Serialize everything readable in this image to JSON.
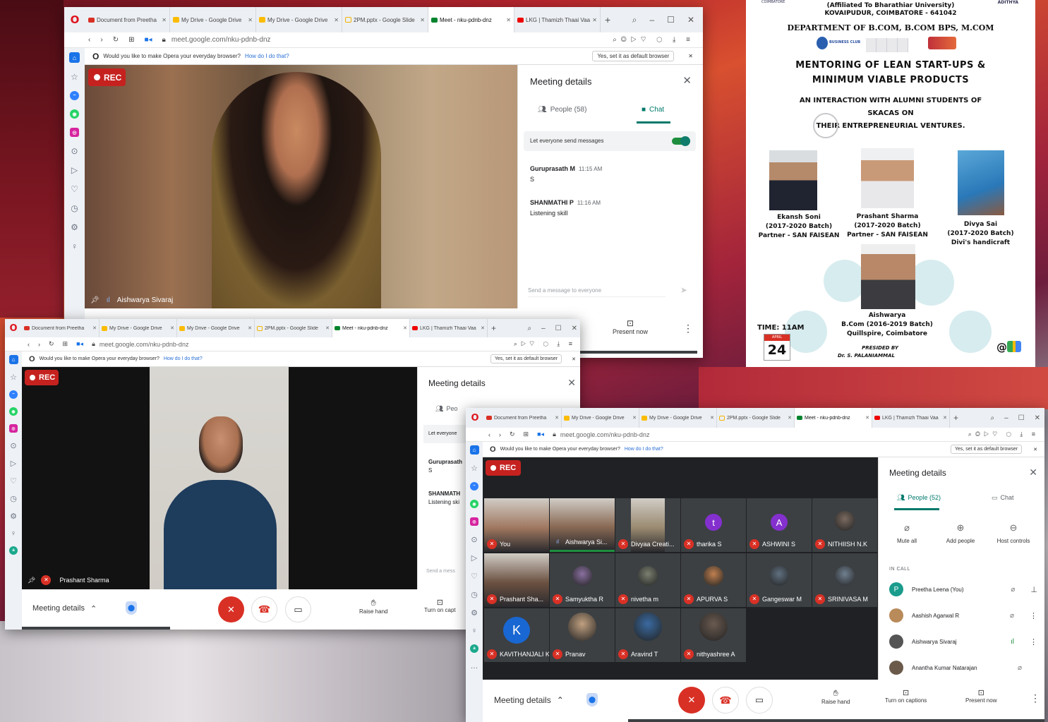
{
  "tabs": [
    "Document from Preetha",
    "My Drive - Google Drive",
    "My Drive - Google Drive",
    "2PM.pptx - Google Slide",
    "Meet - nku-pdnb-dnz",
    "LKG | Thamizh Thaai Vaa"
  ],
  "url": {
    "host": "meet.google.com",
    "path": "/nku-pdnb-dnz"
  },
  "infobar": {
    "message": "Would you like to make Opera your everyday browser?",
    "link": "How do I do that?",
    "button": "Yes, set it as default browser"
  },
  "rec_label": "REC",
  "win1": {
    "speaker": "Aishwarya Sivaraj",
    "panel_title": "Meeting details",
    "people_tab": "People (58)",
    "chat_tab": "Chat",
    "let_everyone": "Let everyone send messages",
    "messages": [
      {
        "name": "Guruprasath M",
        "time": "11:15 AM",
        "text": "S"
      },
      {
        "name": "SHANMATHI P",
        "time": "11:16 AM",
        "text": "Listening skill"
      }
    ],
    "input_placeholder": "Send a message to everyone",
    "present_now": "Present now"
  },
  "win2": {
    "speaker": "Prashant Sharma",
    "panel_title": "Meeting details",
    "people_partial": "Peo",
    "let_partial": "Let everyone",
    "msg1_name": "Guruprasath",
    "msg1_text": "S",
    "msg2_name": "SHANMATH",
    "msg2_text": "Listening ski",
    "input_partial": "Send a mess",
    "meeting_details": "Meeting details",
    "raise_hand": "Raise hand",
    "captions_partial": "Turn on capt"
  },
  "win3": {
    "panel_title": "Meeting details",
    "people_tab": "People (52)",
    "chat_tab": "Chat",
    "mute_all": "Mute all",
    "add_people": "Add people",
    "host_controls": "Host controls",
    "in_call": "IN CALL",
    "people": [
      {
        "name": "Preetha Leena (You)",
        "avatar": "P",
        "color": "#1a9c8c"
      },
      {
        "name": "Aashish Agarwal R",
        "avatar": "",
        "color": "#b98a5a"
      },
      {
        "name": "Aishwarya Sivaraj",
        "avatar": "",
        "color": "#555"
      },
      {
        "name": "Anantha Kumar Natarajan",
        "avatar": "",
        "color": "#6b5a4a"
      }
    ],
    "tiles": [
      {
        "name": "You",
        "avatar": "",
        "color": "#a07860"
      },
      {
        "name": "Aishwarya Si...",
        "avatar": "",
        "color": "#8a6a55"
      },
      {
        "name": "Divyaa Creati...",
        "avatar": "",
        "color": "#9a8a70"
      },
      {
        "name": "tharika S",
        "avatar": "t",
        "color": "#8430ce"
      },
      {
        "name": "ASHWINI S",
        "avatar": "A",
        "color": "#8430ce"
      },
      {
        "name": "NITHIISH N.K",
        "avatar": "",
        "color": "#7a6a60"
      },
      {
        "name": "Prashant Sha...",
        "avatar": "",
        "color": "#6a5040"
      },
      {
        "name": "Samyuktha R",
        "avatar": "",
        "color": "#8a70a0"
      },
      {
        "name": "nivetha m",
        "avatar": "",
        "color": "#7a8070"
      },
      {
        "name": "APURVA S",
        "avatar": "",
        "color": "#c08050"
      },
      {
        "name": "Gangeswar M",
        "avatar": "",
        "color": "#607080"
      },
      {
        "name": "SRINIVASA M",
        "avatar": "",
        "color": "#708090"
      },
      {
        "name": "KAVITHANJALI K",
        "avatar": "K",
        "color": "#1967d2"
      },
      {
        "name": "Pranav",
        "avatar": "",
        "color": "#c0a080"
      },
      {
        "name": "Aravind T",
        "avatar": "",
        "color": "#3a6aa0"
      },
      {
        "name": "nithyashree A",
        "avatar": "",
        "color": "#6a5a50"
      }
    ],
    "meeting_details": "Meeting details",
    "raise_hand": "Raise hand",
    "captions": "Turn on captions",
    "present_now": "Present now"
  },
  "poster": {
    "aff": "(Affiliated To Bharathiar University)",
    "city": "KOVAIPUDUR, COIMBATORE - 641042",
    "left_top": "COIMBATORE",
    "right_top": "ADITHYA",
    "dept": "DEPARTMENT OF B.COM, B.COM BPS, M.COM",
    "badge": "BUSINESS CLUB",
    "title1": "MENTORING OF LEAN START-UPS &",
    "title2": "MINIMUM VIABLE PRODUCTS",
    "sub1": "AN INTERACTION WITH ALUMNI STUDENTS OF",
    "sub2": "SKACAS ON",
    "sub3": "THEIR ENTREPRENEURIAL VENTURES.",
    "p1": [
      "Ekansh Soni",
      "(2017-2020 Batch)",
      "Partner - SAN FAISEAN"
    ],
    "p2": [
      "Prashant Sharma",
      "(2017-2020 Batch)",
      "Partner - SAN FAISEAN"
    ],
    "p3": [
      "Divya Sai",
      "(2017-2020 Batch)",
      "Divi's handicraft"
    ],
    "p4": [
      "Aishwarya",
      "B.Com (2016-2019 Batch)",
      "Quillspire, Coimbatore"
    ],
    "time": "TIME: 11AM",
    "month": "APRIL",
    "day": "24",
    "presided": "PRESIDED BY",
    "presider": "Dr. S. PALANIAMMAL",
    "at": "@"
  }
}
